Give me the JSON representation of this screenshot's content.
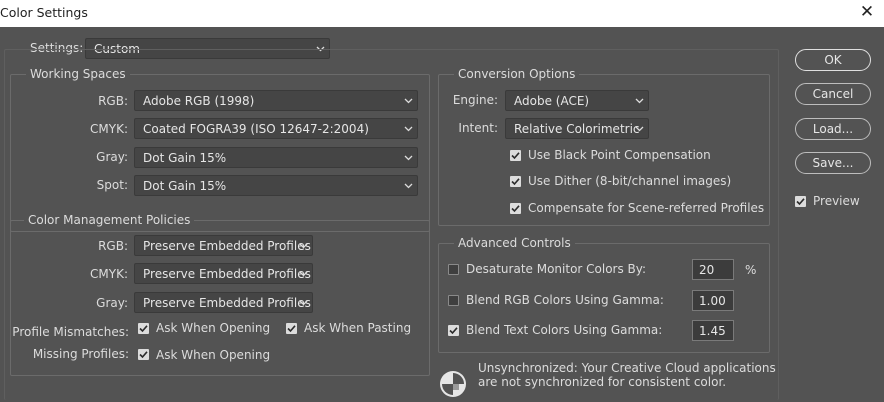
{
  "window": {
    "title": "Color Settings"
  },
  "settings": {
    "label": "Settings:",
    "value": "Custom"
  },
  "working_spaces": {
    "title": "Working Spaces",
    "rows": [
      {
        "label": "RGB:",
        "value": "Adobe RGB (1998)"
      },
      {
        "label": "CMYK:",
        "value": "Coated FOGRA39 (ISO 12647-2:2004)"
      },
      {
        "label": "Gray:",
        "value": "Dot Gain 15%"
      },
      {
        "label": "Spot:",
        "value": "Dot Gain 15%"
      }
    ]
  },
  "policies": {
    "title": "Color Management Policies",
    "rows": [
      {
        "label": "RGB:",
        "value": "Preserve Embedded Profiles"
      },
      {
        "label": "CMYK:",
        "value": "Preserve Embedded Profiles"
      },
      {
        "label": "Gray:",
        "value": "Preserve Embedded Profiles"
      }
    ],
    "mismatches": {
      "label": "Profile Mismatches:",
      "ask_opening": "Ask When Opening",
      "ask_opening_checked": true,
      "ask_pasting": "Ask When Pasting",
      "ask_pasting_checked": true
    },
    "missing": {
      "label": "Missing Profiles:",
      "ask_opening": "Ask When Opening",
      "ask_opening_checked": true
    }
  },
  "conversion": {
    "title": "Conversion Options",
    "engine_label": "Engine:",
    "engine_value": "Adobe (ACE)",
    "intent_label": "Intent:",
    "intent_value": "Relative Colorimetric",
    "checks": [
      {
        "label": "Use Black Point Compensation",
        "checked": true
      },
      {
        "label": "Use Dither (8-bit/channel images)",
        "checked": true
      },
      {
        "label": "Compensate for Scene-referred Profiles",
        "checked": true
      }
    ]
  },
  "advanced": {
    "title": "Advanced Controls",
    "rows": [
      {
        "label": "Desaturate Monitor Colors By:",
        "value": "20",
        "unit": "%",
        "checked": false
      },
      {
        "label": "Blend RGB Colors Using Gamma:",
        "value": "1.00",
        "checked": false
      },
      {
        "label": "Blend Text Colors Using Gamma:",
        "value": "1.45",
        "checked": true
      }
    ]
  },
  "sync": {
    "line1": "Unsynchronized: Your Creative Cloud applications",
    "line2": "are not synchronized for consistent color.",
    "icon": "sync-status-icon"
  },
  "buttons": {
    "ok": "OK",
    "cancel": "Cancel",
    "load": "Load...",
    "save": "Save...",
    "preview": "Preview",
    "preview_checked": true
  },
  "colors": {
    "background": "#535353",
    "titlebar": "#ffffff",
    "field": "#454545",
    "text": "#dcdcdc"
  }
}
